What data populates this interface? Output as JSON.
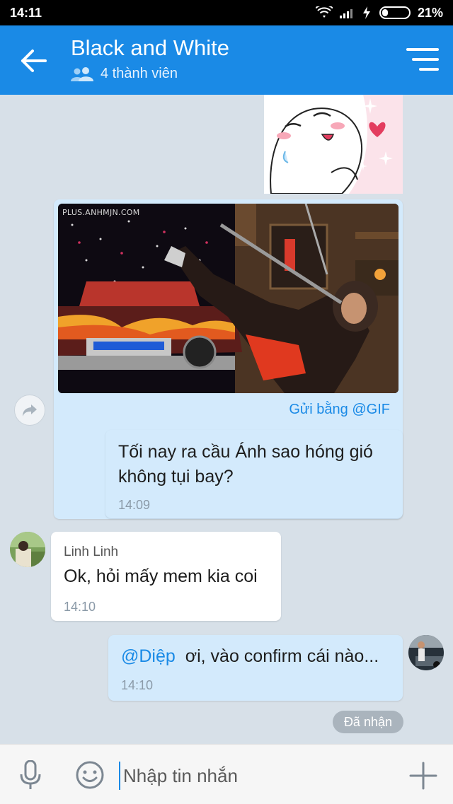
{
  "status_bar": {
    "time": "14:11",
    "battery_percent": "21%"
  },
  "header": {
    "title": "Black and White",
    "members": "4 thành viên",
    "accent_color": "#1a8ae6"
  },
  "gif_message": {
    "watermark": "PLUS.ANHMJN.COM",
    "via_label": "Gửi bằng @GIF"
  },
  "messages": [
    {
      "side": "me",
      "text": "Tối nay ra cầu Ánh sao hóng gió không tụi bay?",
      "time": "14:09"
    },
    {
      "side": "other",
      "sender": "Linh Linh",
      "text": "Ok, hỏi mấy mem kia coi",
      "time": "14:10"
    },
    {
      "side": "me",
      "mention": "@Diệp",
      "text": "ơi, vào confirm cái nào...",
      "time": "14:10"
    }
  ],
  "received_label": "Đã nhận",
  "composer": {
    "placeholder": "Nhập tin nhắn"
  },
  "icons": [
    "back-arrow-icon",
    "members-icon",
    "menu-icon",
    "share-icon",
    "mic-icon",
    "emoji-icon",
    "plus-icon",
    "wifi-icon",
    "signal-icon",
    "charging-icon",
    "battery-icon"
  ]
}
